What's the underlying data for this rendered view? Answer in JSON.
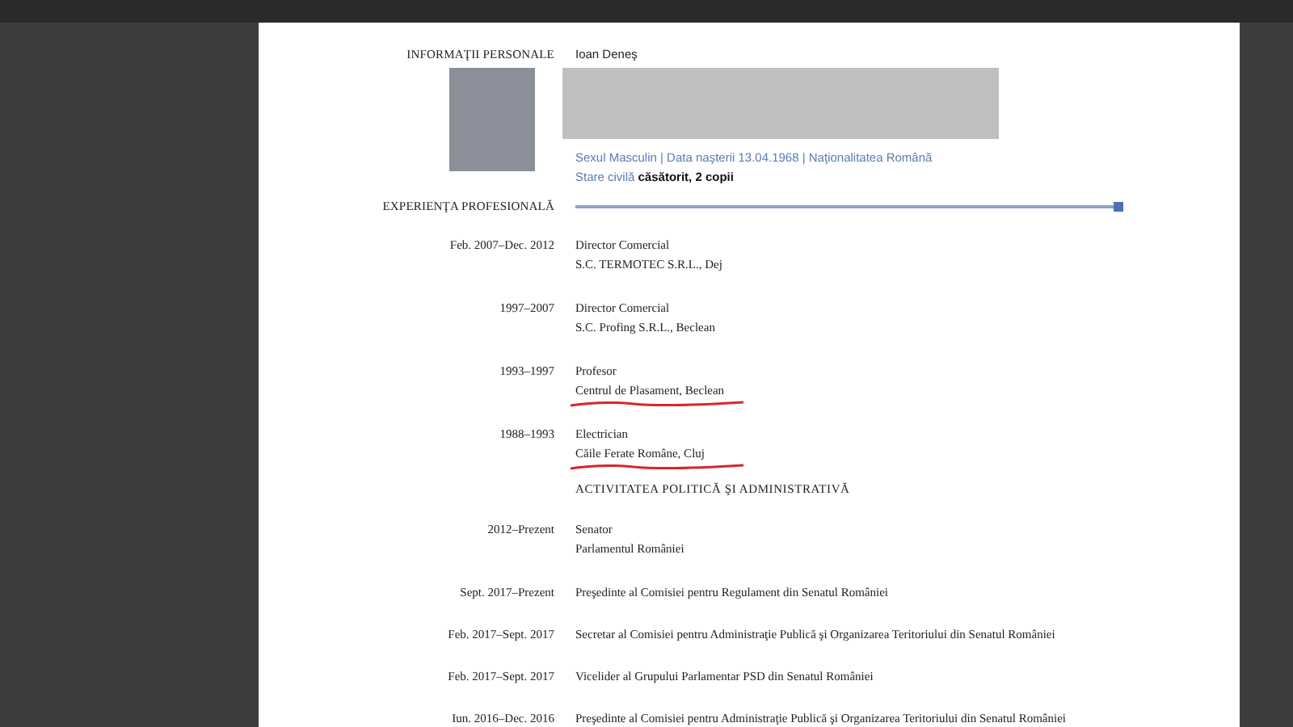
{
  "personal": {
    "heading": "INFORMAŢII PERSONALE",
    "name": "Ioan Deneş",
    "details": "Sexul Masculin | Data naşterii 13.04.1968 | Naţionalitatea Română",
    "civil": "Stare civilă **căsătorit, 2 copii**"
  },
  "experience": {
    "heading": "EXPERIENŢA PROFESIONALĂ",
    "entries": [
      {
        "period": "Feb. 2007–Dec. 2012",
        "title": "Director Comercial",
        "organization": "S.C. TERMOTEC S.R.L., Dej",
        "underlined": false
      },
      {
        "period": "1997–2007",
        "title": "Director Comercial",
        "organization": "S.C. Profing S.R.L., Beclean",
        "underlined": false
      },
      {
        "period": "1993–1997",
        "title": "Profesor",
        "organization": "Centrul de Plasament, Beclean",
        "underlined": true
      },
      {
        "period": "1988–1993",
        "title": "Electrician",
        "organization": "Căile Ferate Române, Cluj",
        "underlined": true
      }
    ]
  },
  "activity": {
    "heading": "ACTIVITATEA POLITICĂ ŞI ADMINISTRATIVĂ",
    "entries": [
      {
        "period": "2012–Prezent",
        "lines": [
          "Senator",
          "Parlamentul României"
        ]
      },
      {
        "period": "Sept. 2017–Prezent",
        "lines": [
          "Preşedinte al Comisiei pentru Regulament din Senatul României"
        ]
      },
      {
        "period": "Feb. 2017–Sept. 2017",
        "lines": [
          "Secretar al Comisiei pentru Administraţie Publică şi Organizarea Teritoriului din Senatul României"
        ]
      },
      {
        "period": "Feb. 2017–Sept. 2017",
        "lines": [
          "Vicelider al Grupului Parlamentar PSD din Senatul României"
        ]
      },
      {
        "period": "Iun. 2016–Dec. 2016",
        "lines": [
          "Preşedinte al Comisiei pentru Administraţie Publică şi Organizarea Teritoriului din Senatul României"
        ]
      }
    ]
  }
}
